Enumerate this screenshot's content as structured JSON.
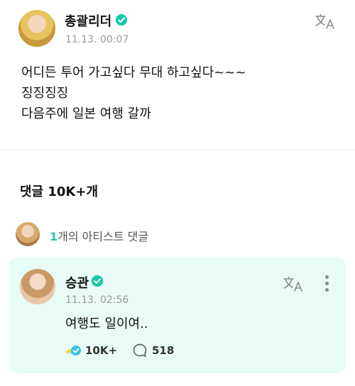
{
  "post": {
    "author": "총괄리더",
    "time": "11.13. 00:07",
    "lines": [
      "어디든 투어 가고싶다 무대 하고싶다~~~",
      "징징징징",
      "다음주에 일본 여행 갈까"
    ]
  },
  "comments_section": {
    "heading": "댓글 10K+개",
    "artist_comments_count": "1",
    "artist_comments_label": "개의 아티스트 댓글"
  },
  "comment": {
    "author": "승관",
    "time": "11.13. 02:56",
    "text": "여행도 일이여..",
    "cheer_count": "10K+",
    "reply_count": "518"
  },
  "icons": {
    "verified": "verified-check-icon",
    "translate": "translate-icon",
    "more": "more-vertical-icon",
    "cheer": "cheer-icon",
    "reply": "speech-bubble-icon"
  },
  "colors": {
    "accent": "#1cc7a8",
    "card_bg": "#e8fbf6",
    "muted_text": "#9a9a9a"
  }
}
